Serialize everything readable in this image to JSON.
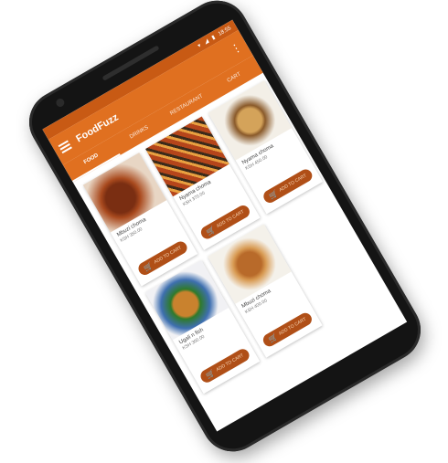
{
  "status": {
    "time": "18:55"
  },
  "app": {
    "title": "FoodFuzz"
  },
  "tabs": [
    "FOOD",
    "DRINKS",
    "RESTAURANT",
    "CART"
  ],
  "products": [
    {
      "name": "Mbuzi choma",
      "price": "KSH 350.00",
      "button": "ADD TO CART"
    },
    {
      "name": "Nyama choma",
      "price": "KSH 370.00",
      "button": "ADD TO CART"
    },
    {
      "name": "Nyama choma",
      "price": "KSH 450.00",
      "button": "ADD TO CART"
    },
    {
      "name": "Ugali n fish",
      "price": "KSH 300.00",
      "button": "ADD TO CART"
    },
    {
      "name": "Mbuzi choma",
      "price": "KSH 400.00",
      "button": "ADD TO CART"
    }
  ],
  "colors": {
    "primary": "#e07020",
    "status": "#c85a14",
    "button": "#b04f17"
  }
}
